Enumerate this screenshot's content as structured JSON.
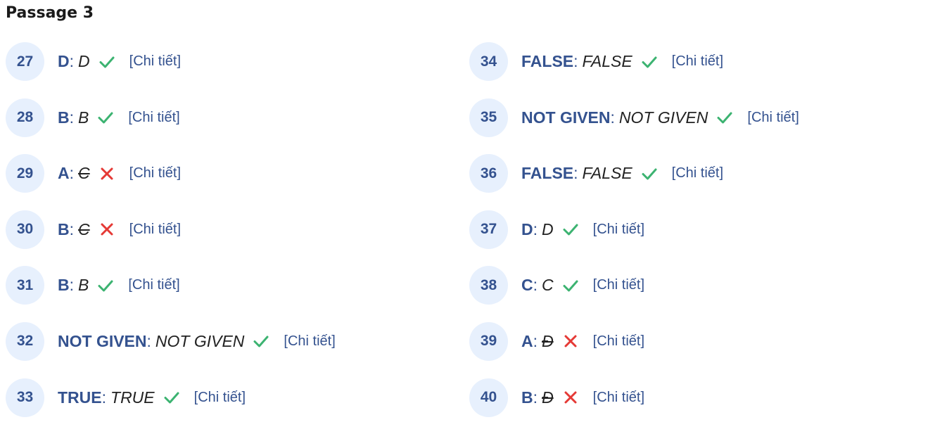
{
  "title": "Passage 3",
  "colors": {
    "correct": "#3cb371",
    "wrong": "#e53935",
    "accent": "#34528f",
    "badge": "#e7f0fd"
  },
  "left": [
    {
      "num": "27",
      "correct": "D",
      "user": "D",
      "ok": true,
      "detail": "[Chi tiết]"
    },
    {
      "num": "28",
      "correct": "B",
      "user": "B",
      "ok": true,
      "detail": "[Chi tiết]"
    },
    {
      "num": "29",
      "correct": "A",
      "user": "C",
      "ok": false,
      "detail": "[Chi tiết]"
    },
    {
      "num": "30",
      "correct": "B",
      "user": "C",
      "ok": false,
      "detail": "[Chi tiết]"
    },
    {
      "num": "31",
      "correct": "B",
      "user": "B",
      "ok": true,
      "detail": "[Chi tiết]"
    },
    {
      "num": "32",
      "correct": "NOT GIVEN",
      "user": "NOT GIVEN",
      "ok": true,
      "detail": "[Chi tiết]"
    },
    {
      "num": "33",
      "correct": "TRUE",
      "user": "TRUE",
      "ok": true,
      "detail": "[Chi tiết]"
    }
  ],
  "right": [
    {
      "num": "34",
      "correct": "FALSE",
      "user": "FALSE",
      "ok": true,
      "detail": "[Chi tiết]"
    },
    {
      "num": "35",
      "correct": "NOT GIVEN",
      "user": "NOT GIVEN",
      "ok": true,
      "detail": "[Chi tiết]"
    },
    {
      "num": "36",
      "correct": "FALSE",
      "user": "FALSE",
      "ok": true,
      "detail": "[Chi tiết]"
    },
    {
      "num": "37",
      "correct": "D",
      "user": "D",
      "ok": true,
      "detail": "[Chi tiết]"
    },
    {
      "num": "38",
      "correct": "C",
      "user": "C",
      "ok": true,
      "detail": "[Chi tiết]"
    },
    {
      "num": "39",
      "correct": "A",
      "user": "Đ",
      "ok": false,
      "detail": "[Chi tiết]"
    },
    {
      "num": "40",
      "correct": "B",
      "user": "Đ",
      "ok": false,
      "detail": "[Chi tiết]"
    }
  ]
}
